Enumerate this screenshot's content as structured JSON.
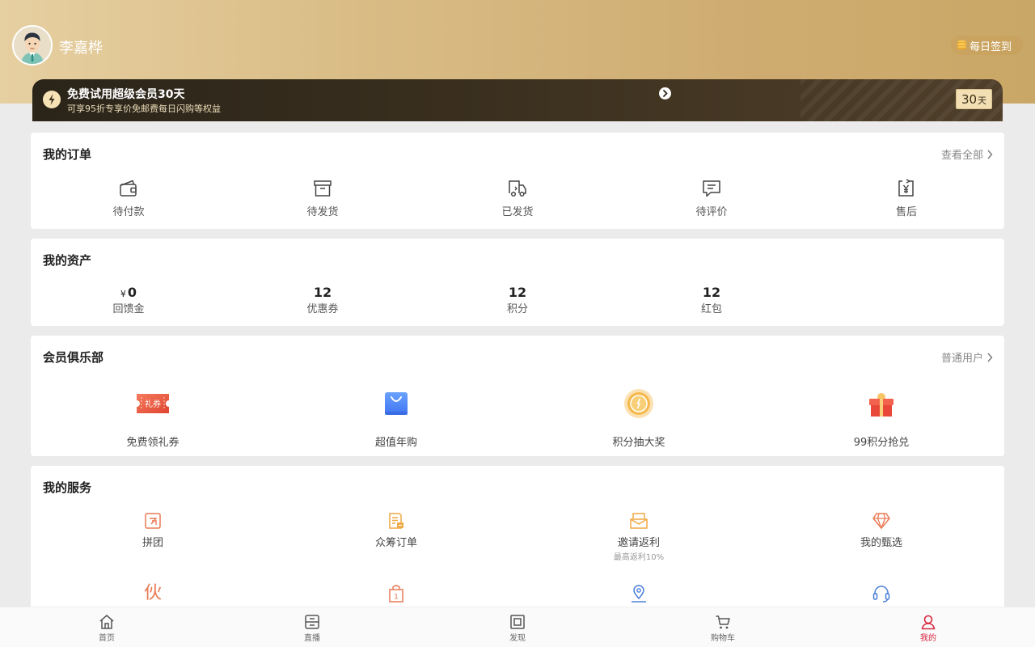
{
  "profile": {
    "name": "李嘉桦",
    "checkin_label": "每日签到"
  },
  "vip": {
    "title": "免费试用超级会员30天",
    "subtitle": "可享95折专享价免邮费每日闪购等权益",
    "days": "30",
    "days_unit": "天"
  },
  "orders": {
    "title": "我的订单",
    "view_all": "查看全部",
    "items": [
      {
        "label": "待付款",
        "icon": "wallet-icon"
      },
      {
        "label": "待发货",
        "icon": "box-icon"
      },
      {
        "label": "已发货",
        "icon": "truck-icon"
      },
      {
        "label": "待评价",
        "icon": "comment-icon"
      },
      {
        "label": "售后",
        "icon": "refund-icon"
      }
    ]
  },
  "assets": {
    "title": "我的资产",
    "items": [
      {
        "prefix": "¥",
        "value": "0",
        "label": "回馈金"
      },
      {
        "value": "12",
        "label": "优惠券"
      },
      {
        "value": "12",
        "label": "积分"
      },
      {
        "value": "12",
        "label": "红包"
      }
    ]
  },
  "club": {
    "title": "会员俱乐部",
    "level": "普通用户",
    "items": [
      {
        "label": "免费领礼券",
        "icon": "coupon-icon",
        "badge": "礼券"
      },
      {
        "label": "超值年购",
        "icon": "shopping-bag-icon"
      },
      {
        "label": "积分抽大奖",
        "icon": "medal-icon"
      },
      {
        "label": "99积分抢兑",
        "icon": "gift-icon"
      }
    ]
  },
  "services": {
    "title": "我的服务",
    "items": [
      {
        "label": "拼团",
        "icon": "group-buy-icon"
      },
      {
        "label": "众筹订单",
        "icon": "crowdfunding-icon"
      },
      {
        "label": "邀请返利",
        "icon": "invite-icon",
        "sub": "最高返利10%"
      },
      {
        "label": "我的甄选",
        "icon": "diamond-icon"
      },
      {
        "icon": "partner-icon",
        "glyph": "伙"
      },
      {
        "icon": "bag-number-icon",
        "glyph": "1"
      },
      {
        "icon": "location-icon"
      },
      {
        "icon": "headset-icon"
      }
    ]
  },
  "tabbar": {
    "items": [
      {
        "label": "首页",
        "icon": "home-icon"
      },
      {
        "label": "直播",
        "icon": "live-icon"
      },
      {
        "label": "发现",
        "icon": "discover-icon"
      },
      {
        "label": "购物车",
        "icon": "cart-icon"
      },
      {
        "label": "我的",
        "icon": "profile-icon",
        "active": true
      }
    ]
  },
  "colors": {
    "accent": "#d8263e",
    "gold": "#d4b277",
    "service_orange": "#ea7a55"
  }
}
